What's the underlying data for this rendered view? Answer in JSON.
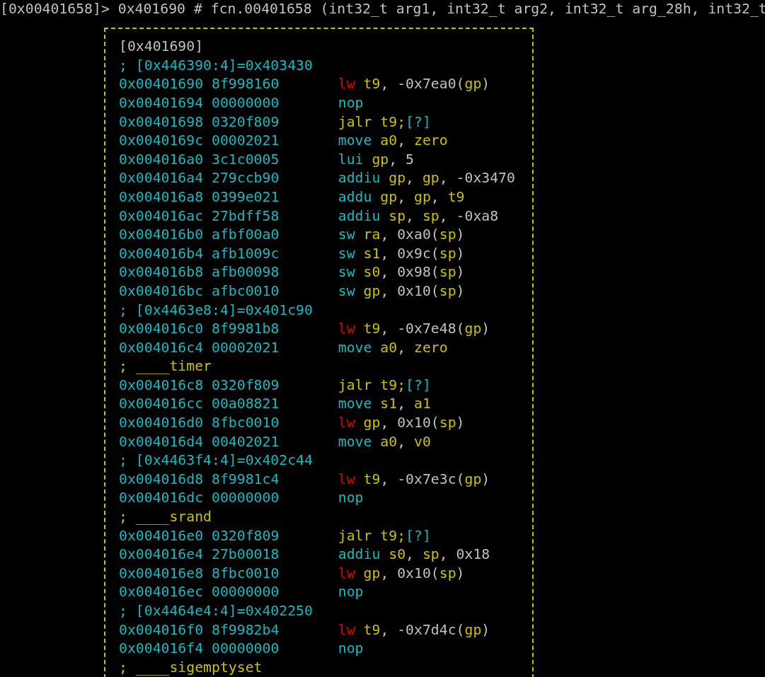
{
  "prompt_line": "[0x00401658]> 0x401690 # fcn.00401658 (int32_t arg1, int32_t arg2, int32_t arg_28h, int32_t",
  "block": {
    "title": "[0x401690]",
    "lines": [
      {
        "kind": "ref_comment",
        "text": "; [0x446390:4]=0x403430"
      },
      {
        "kind": "instruction",
        "address": "0x00401690",
        "bytes": "8f998160",
        "mnemonic": {
          "kind": "load",
          "text": "lw"
        },
        "operands": [
          {
            "kind": "reg",
            "text": "t9"
          },
          {
            "kind": "punct",
            "text": ", "
          },
          {
            "kind": "imm",
            "text": "-0x7ea0"
          },
          {
            "kind": "punct",
            "text": "("
          },
          {
            "kind": "reg",
            "text": "gp"
          },
          {
            "kind": "punct",
            "text": ")"
          }
        ]
      },
      {
        "kind": "instruction",
        "address": "0x00401694",
        "bytes": "00000000",
        "mnemonic": {
          "kind": "other",
          "text": "nop"
        }
      },
      {
        "kind": "instruction",
        "address": "0x00401698",
        "bytes": "0320f809",
        "mnemonic": {
          "kind": "call",
          "text": "jalr"
        },
        "operands": [
          {
            "kind": "reg",
            "text": "t9;"
          },
          {
            "kind": "ref",
            "text": "[?]"
          }
        ]
      },
      {
        "kind": "instruction",
        "address": "0x0040169c",
        "bytes": "00002021",
        "mnemonic": {
          "kind": "other",
          "text": "move"
        },
        "operands": [
          {
            "kind": "reg",
            "text": "a0"
          },
          {
            "kind": "punct",
            "text": ", "
          },
          {
            "kind": "reg",
            "text": "zero"
          }
        ]
      },
      {
        "kind": "instruction",
        "address": "0x004016a0",
        "bytes": "3c1c0005",
        "mnemonic": {
          "kind": "other",
          "text": "lui"
        },
        "operands": [
          {
            "kind": "reg",
            "text": "gp"
          },
          {
            "kind": "punct",
            "text": ", "
          },
          {
            "kind": "imm",
            "text": "5"
          }
        ]
      },
      {
        "kind": "instruction",
        "address": "0x004016a4",
        "bytes": "279ccb90",
        "mnemonic": {
          "kind": "other",
          "text": "addiu"
        },
        "operands": [
          {
            "kind": "reg",
            "text": "gp"
          },
          {
            "kind": "punct",
            "text": ", "
          },
          {
            "kind": "reg",
            "text": "gp"
          },
          {
            "kind": "punct",
            "text": ", "
          },
          {
            "kind": "imm",
            "text": "-0x3470"
          }
        ]
      },
      {
        "kind": "instruction",
        "address": "0x004016a8",
        "bytes": "0399e021",
        "mnemonic": {
          "kind": "other",
          "text": "addu"
        },
        "operands": [
          {
            "kind": "reg",
            "text": "gp"
          },
          {
            "kind": "punct",
            "text": ", "
          },
          {
            "kind": "reg",
            "text": "gp"
          },
          {
            "kind": "punct",
            "text": ", "
          },
          {
            "kind": "reg",
            "text": "t9"
          }
        ]
      },
      {
        "kind": "instruction",
        "address": "0x004016ac",
        "bytes": "27bdff58",
        "mnemonic": {
          "kind": "other",
          "text": "addiu"
        },
        "operands": [
          {
            "kind": "reg",
            "text": "sp"
          },
          {
            "kind": "punct",
            "text": ", "
          },
          {
            "kind": "reg",
            "text": "sp"
          },
          {
            "kind": "punct",
            "text": ", "
          },
          {
            "kind": "imm",
            "text": "-0xa8"
          }
        ]
      },
      {
        "kind": "instruction",
        "address": "0x004016b0",
        "bytes": "afbf00a0",
        "mnemonic": {
          "kind": "other",
          "text": "sw"
        },
        "operands": [
          {
            "kind": "reg",
            "text": "ra"
          },
          {
            "kind": "punct",
            "text": ", "
          },
          {
            "kind": "imm",
            "text": "0xa0"
          },
          {
            "kind": "punct",
            "text": "("
          },
          {
            "kind": "reg",
            "text": "sp"
          },
          {
            "kind": "punct",
            "text": ")"
          }
        ]
      },
      {
        "kind": "instruction",
        "address": "0x004016b4",
        "bytes": "afb1009c",
        "mnemonic": {
          "kind": "other",
          "text": "sw"
        },
        "operands": [
          {
            "kind": "reg",
            "text": "s1"
          },
          {
            "kind": "punct",
            "text": ", "
          },
          {
            "kind": "imm",
            "text": "0x9c"
          },
          {
            "kind": "punct",
            "text": "("
          },
          {
            "kind": "reg",
            "text": "sp"
          },
          {
            "kind": "punct",
            "text": ")"
          }
        ]
      },
      {
        "kind": "instruction",
        "address": "0x004016b8",
        "bytes": "afb00098",
        "mnemonic": {
          "kind": "other",
          "text": "sw"
        },
        "operands": [
          {
            "kind": "reg",
            "text": "s0"
          },
          {
            "kind": "punct",
            "text": ", "
          },
          {
            "kind": "imm",
            "text": "0x98"
          },
          {
            "kind": "punct",
            "text": "("
          },
          {
            "kind": "reg",
            "text": "sp"
          },
          {
            "kind": "punct",
            "text": ")"
          }
        ]
      },
      {
        "kind": "instruction",
        "address": "0x004016bc",
        "bytes": "afbc0010",
        "mnemonic": {
          "kind": "other",
          "text": "sw"
        },
        "operands": [
          {
            "kind": "reg",
            "text": "gp"
          },
          {
            "kind": "punct",
            "text": ", "
          },
          {
            "kind": "imm",
            "text": "0x10"
          },
          {
            "kind": "punct",
            "text": "("
          },
          {
            "kind": "reg",
            "text": "sp"
          },
          {
            "kind": "punct",
            "text": ")"
          }
        ]
      },
      {
        "kind": "ref_comment",
        "text": "; [0x4463e8:4]=0x401c90"
      },
      {
        "kind": "instruction",
        "address": "0x004016c0",
        "bytes": "8f9981b8",
        "mnemonic": {
          "kind": "load",
          "text": "lw"
        },
        "operands": [
          {
            "kind": "reg",
            "text": "t9"
          },
          {
            "kind": "punct",
            "text": ", "
          },
          {
            "kind": "imm",
            "text": "-0x7e48"
          },
          {
            "kind": "punct",
            "text": "("
          },
          {
            "kind": "reg",
            "text": "gp"
          },
          {
            "kind": "punct",
            "text": ")"
          }
        ]
      },
      {
        "kind": "instruction",
        "address": "0x004016c4",
        "bytes": "00002021",
        "mnemonic": {
          "kind": "other",
          "text": "move"
        },
        "operands": [
          {
            "kind": "reg",
            "text": "a0"
          },
          {
            "kind": "punct",
            "text": ", "
          },
          {
            "kind": "reg",
            "text": "zero"
          }
        ]
      },
      {
        "kind": "flag_comment",
        "text": "; ____timer"
      },
      {
        "kind": "instruction",
        "address": "0x004016c8",
        "bytes": "0320f809",
        "mnemonic": {
          "kind": "call",
          "text": "jalr"
        },
        "operands": [
          {
            "kind": "reg",
            "text": "t9;"
          },
          {
            "kind": "ref",
            "text": "[?]"
          }
        ]
      },
      {
        "kind": "instruction",
        "address": "0x004016cc",
        "bytes": "00a08821",
        "mnemonic": {
          "kind": "other",
          "text": "move"
        },
        "operands": [
          {
            "kind": "reg",
            "text": "s1"
          },
          {
            "kind": "punct",
            "text": ", "
          },
          {
            "kind": "reg",
            "text": "a1"
          }
        ]
      },
      {
        "kind": "instruction",
        "address": "0x004016d0",
        "bytes": "8fbc0010",
        "mnemonic": {
          "kind": "load",
          "text": "lw"
        },
        "operands": [
          {
            "kind": "reg",
            "text": "gp"
          },
          {
            "kind": "punct",
            "text": ", "
          },
          {
            "kind": "imm",
            "text": "0x10"
          },
          {
            "kind": "punct",
            "text": "("
          },
          {
            "kind": "reg",
            "text": "sp"
          },
          {
            "kind": "punct",
            "text": ")"
          }
        ]
      },
      {
        "kind": "instruction",
        "address": "0x004016d4",
        "bytes": "00402021",
        "mnemonic": {
          "kind": "other",
          "text": "move"
        },
        "operands": [
          {
            "kind": "reg",
            "text": "a0"
          },
          {
            "kind": "punct",
            "text": ", "
          },
          {
            "kind": "reg",
            "text": "v0"
          }
        ]
      },
      {
        "kind": "ref_comment",
        "text": "; [0x4463f4:4]=0x402c44"
      },
      {
        "kind": "instruction",
        "address": "0x004016d8",
        "bytes": "8f9981c4",
        "mnemonic": {
          "kind": "load",
          "text": "lw"
        },
        "operands": [
          {
            "kind": "reg",
            "text": "t9"
          },
          {
            "kind": "punct",
            "text": ", "
          },
          {
            "kind": "imm",
            "text": "-0x7e3c"
          },
          {
            "kind": "punct",
            "text": "("
          },
          {
            "kind": "reg",
            "text": "gp"
          },
          {
            "kind": "punct",
            "text": ")"
          }
        ]
      },
      {
        "kind": "instruction",
        "address": "0x004016dc",
        "bytes": "00000000",
        "mnemonic": {
          "kind": "other",
          "text": "nop"
        }
      },
      {
        "kind": "flag_comment",
        "text": "; ____srand"
      },
      {
        "kind": "instruction",
        "address": "0x004016e0",
        "bytes": "0320f809",
        "mnemonic": {
          "kind": "call",
          "text": "jalr"
        },
        "operands": [
          {
            "kind": "reg",
            "text": "t9;"
          },
          {
            "kind": "ref",
            "text": "[?]"
          }
        ]
      },
      {
        "kind": "instruction",
        "address": "0x004016e4",
        "bytes": "27b00018",
        "mnemonic": {
          "kind": "other",
          "text": "addiu"
        },
        "operands": [
          {
            "kind": "reg",
            "text": "s0"
          },
          {
            "kind": "punct",
            "text": ", "
          },
          {
            "kind": "reg",
            "text": "sp"
          },
          {
            "kind": "punct",
            "text": ", "
          },
          {
            "kind": "imm",
            "text": "0x18"
          }
        ]
      },
      {
        "kind": "instruction",
        "address": "0x004016e8",
        "bytes": "8fbc0010",
        "mnemonic": {
          "kind": "load",
          "text": "lw"
        },
        "operands": [
          {
            "kind": "reg",
            "text": "gp"
          },
          {
            "kind": "punct",
            "text": ", "
          },
          {
            "kind": "imm",
            "text": "0x10"
          },
          {
            "kind": "punct",
            "text": "("
          },
          {
            "kind": "reg",
            "text": "sp"
          },
          {
            "kind": "punct",
            "text": ")"
          }
        ]
      },
      {
        "kind": "instruction",
        "address": "0x004016ec",
        "bytes": "00000000",
        "mnemonic": {
          "kind": "other",
          "text": "nop"
        }
      },
      {
        "kind": "ref_comment",
        "text": "; [0x4464e4:4]=0x402250"
      },
      {
        "kind": "instruction",
        "address": "0x004016f0",
        "bytes": "8f9982b4",
        "mnemonic": {
          "kind": "load",
          "text": "lw"
        },
        "operands": [
          {
            "kind": "reg",
            "text": "t9"
          },
          {
            "kind": "punct",
            "text": ", "
          },
          {
            "kind": "imm",
            "text": "-0x7d4c"
          },
          {
            "kind": "punct",
            "text": "("
          },
          {
            "kind": "reg",
            "text": "gp"
          },
          {
            "kind": "punct",
            "text": ")"
          }
        ]
      },
      {
        "kind": "instruction",
        "address": "0x004016f4",
        "bytes": "00000000",
        "mnemonic": {
          "kind": "other",
          "text": "nop"
        }
      },
      {
        "kind": "flag_comment",
        "text": "; ____sigemptyset"
      }
    ]
  }
}
